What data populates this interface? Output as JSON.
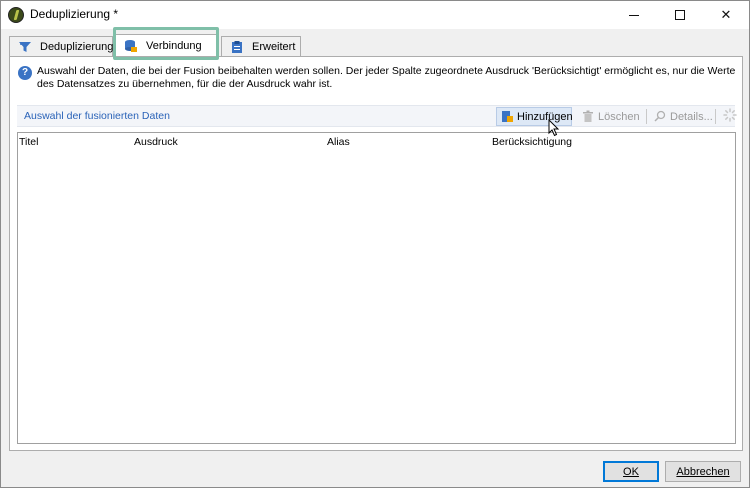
{
  "window": {
    "title": "Deduplizierung *"
  },
  "tabs": [
    {
      "label": "Deduplizierung",
      "icon": "funnel-icon"
    },
    {
      "label": "Verbindung",
      "icon": "database-icon",
      "selected": true
    },
    {
      "label": "Erweitert",
      "icon": "clipboard-icon"
    }
  ],
  "info": {
    "text": "Auswahl der Daten, die bei der Fusion beibehalten werden sollen. Der jeder Spalte zugeordnete Ausdruck 'Berücksichtigt' ermöglicht es, nur die Werte des Datensatzes zu übernehmen, für die der Ausdruck wahr ist."
  },
  "toolbar": {
    "section_label": "Auswahl der fusionierten Daten",
    "add_label": "Hinzufügen",
    "delete_label": "Löschen",
    "details_label": "Details..."
  },
  "grid": {
    "columns": [
      "Titel",
      "Ausdruck",
      "Alias",
      "Berücksichtigung"
    ],
    "rows": []
  },
  "buttons": {
    "ok_label": "OK",
    "cancel_label": "Abbrechen"
  },
  "colors": {
    "accent": "#0078d7",
    "highlight": "#7fbfa8",
    "link": "#2a63b8"
  }
}
